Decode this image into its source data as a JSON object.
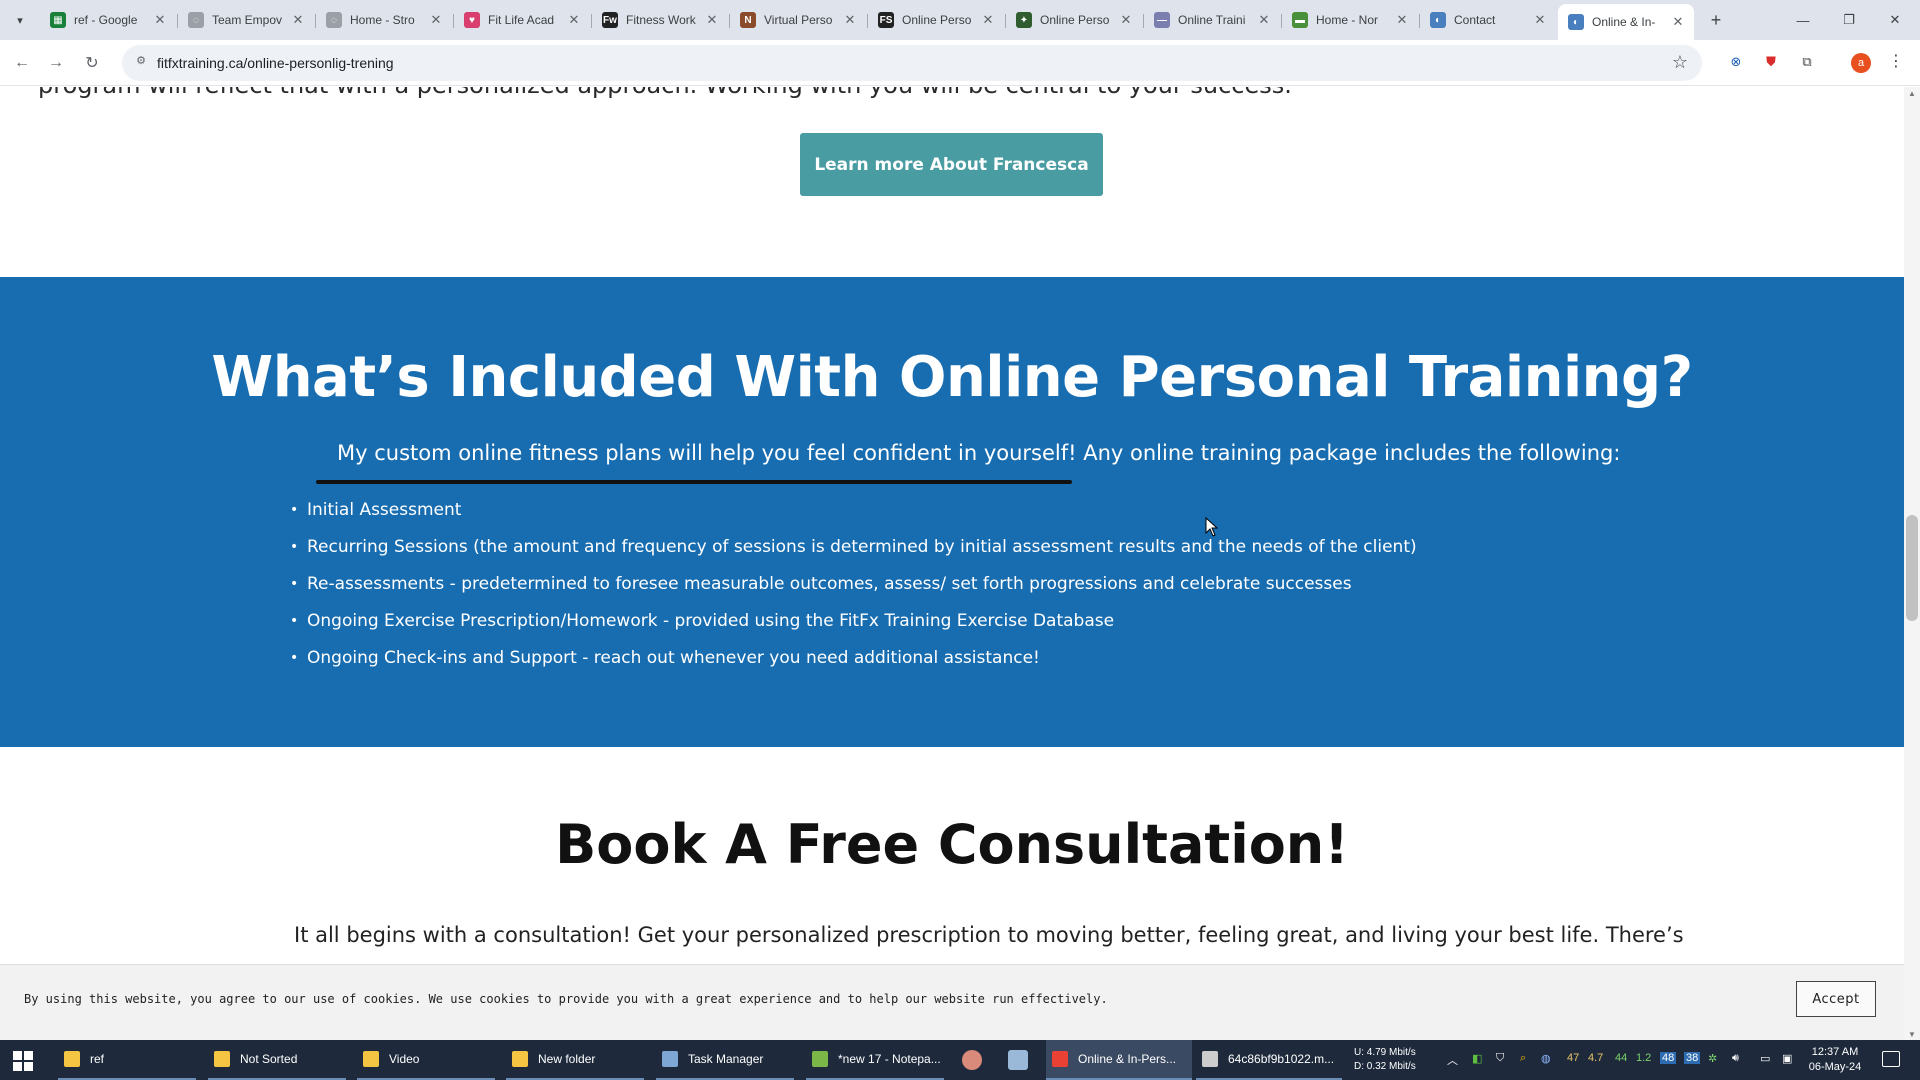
{
  "browser": {
    "tabs": [
      {
        "title": "ref - Google",
        "icon": "google-sheets-icon",
        "color": "#188038",
        "glyph": "▦",
        "active": false
      },
      {
        "title": "Team Empov",
        "icon": "loading-spinner-icon",
        "color": "#9aa0a6",
        "glyph": "◌",
        "active": false
      },
      {
        "title": "Home - Stro",
        "icon": "globe-icon",
        "color": "#9aa0a6",
        "glyph": "◌",
        "active": false
      },
      {
        "title": "Fit Life Acad",
        "icon": "heart-logo-icon",
        "color": "#d93f6e",
        "glyph": "♥",
        "active": false
      },
      {
        "title": "Fitness Work",
        "icon": "fw-logo-icon",
        "color": "#222222",
        "glyph": "Fw",
        "active": false
      },
      {
        "title": "Virtual Perso",
        "icon": "n-logo-icon",
        "color": "#8a4b2a",
        "glyph": "N",
        "active": false
      },
      {
        "title": "Online Perso",
        "icon": "fs-logo-icon",
        "color": "#222222",
        "glyph": "FS",
        "active": false
      },
      {
        "title": "Online Perso",
        "icon": "leaf-logo-icon",
        "color": "#2f5d2f",
        "glyph": "✦",
        "active": false
      },
      {
        "title": "Online Traini",
        "icon": "line-logo-icon",
        "color": "#7a7fb0",
        "glyph": "—",
        "active": false
      },
      {
        "title": "Home - Nor",
        "icon": "green-logo-icon",
        "color": "#4a8f3c",
        "glyph": "▬",
        "active": false
      },
      {
        "title": "Contact",
        "icon": "globe-icon",
        "color": "#4a7fbf",
        "glyph": "◐",
        "active": false
      },
      {
        "title": "Online & In-",
        "icon": "globe-icon",
        "color": "#4a7fbf",
        "glyph": "◐",
        "active": true
      }
    ],
    "url": "fitfxtraining.ca/online-personlig-trening",
    "profile_initial": "a"
  },
  "page": {
    "prev_paragraph_tail": "program will reflect that with a personalized approach. Working with you will be central to your success.",
    "learn_more_button": "Learn more About Francesca",
    "included": {
      "title": "What’s Included With Online Personal Training?",
      "lead": "My custom online fitness plans will help you feel confident in yourself! Any online training package includes the following:",
      "items": [
        "Initial Assessment",
        "Recurring Sessions (the amount and frequency of sessions is determined by initial assessment results and the needs of the client)",
        "Re-assessments - predetermined to foresee measurable outcomes, assess/ set forth progressions and celebrate successes",
        "Ongoing Exercise Prescription/Homework - provided using the FitFx Training Exercise Database",
        "Ongoing Check-ins and Support - reach out whenever you need additional assistance!"
      ],
      "bg_color": "#186db1"
    },
    "book": {
      "title": "Book A Free Consultation!",
      "text": "It all begins with a consultation! Get your personalized prescription to moving better, feeling great, and living your best life. There’s"
    },
    "cookie": {
      "text": "By using this website, you agree to our use of cookies. We use cookies to provide you with a great experience and to help our website run effectively.",
      "accept": "Accept"
    },
    "button_color": "#4a9ca3"
  },
  "taskbar": {
    "items": [
      {
        "label": "ref",
        "icon": "folder-icon",
        "color": "#f4c542"
      },
      {
        "label": "Not Sorted",
        "icon": "folder-icon",
        "color": "#f4c542"
      },
      {
        "label": "Video",
        "icon": "folder-icon",
        "color": "#f4c542"
      },
      {
        "label": "New folder",
        "icon": "folder-icon",
        "color": "#f4c542"
      },
      {
        "label": "Task Manager",
        "icon": "task-manager-icon",
        "color": "#7fa7d6"
      },
      {
        "label": "*new 17 - Notepa...",
        "icon": "notepad-plus-icon",
        "color": "#7ab648"
      },
      {
        "label": "Online & In-Pers...",
        "icon": "chrome-icon",
        "color": "#e94235"
      },
      {
        "label": "64c86bf9b1022.m...",
        "icon": "media-player-icon",
        "color": "#cccccc"
      }
    ],
    "network": {
      "upload": "U:  4.79 Mbit/s",
      "download": "D:  0.32 Mbit/s"
    },
    "tray_numbers": [
      "47",
      "4.7",
      "44",
      "1.2"
    ],
    "tray_badges": [
      "48",
      "38"
    ],
    "time": "12:37 AM",
    "date": "06-May-24"
  }
}
